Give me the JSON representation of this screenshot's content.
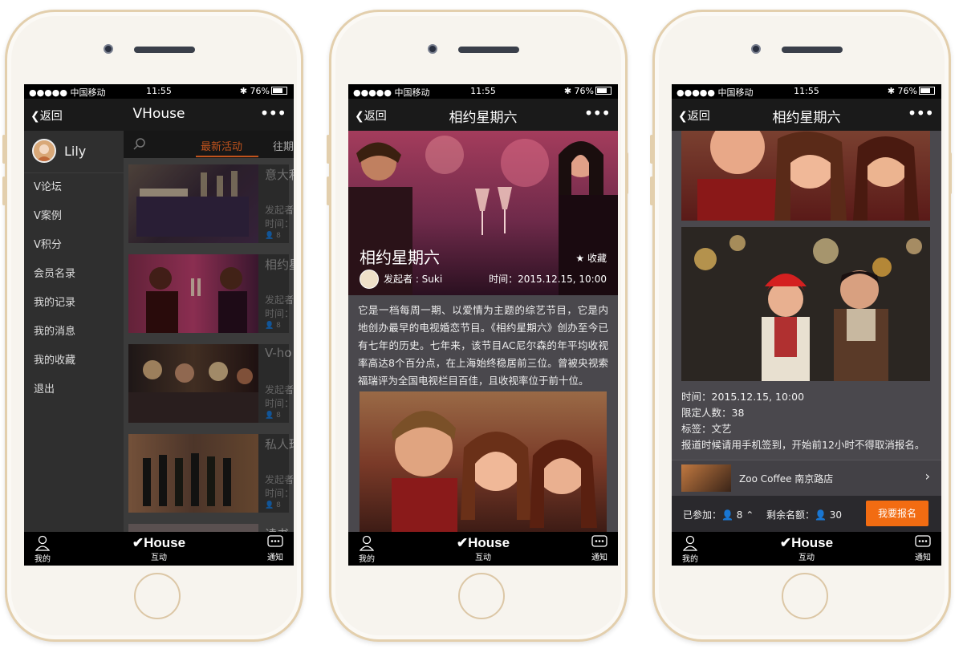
{
  "status": {
    "carrier": "●●●●● 中国移动",
    "time": "11:55",
    "battery": "76%"
  },
  "common": {
    "back": "返回",
    "more": "•••",
    "tab_me": "我的",
    "tab_logo": "House",
    "tab_interact": "互动",
    "tab_notice": "通知"
  },
  "phone1": {
    "title": "VHouse",
    "user": "Lily",
    "menu": [
      "V论坛",
      "V案例",
      "V积分",
      "会员名录",
      "我的记录",
      "我的消息",
      "我的收藏",
      "退出"
    ],
    "tab_latest": "最新活动",
    "tab_past": "往期",
    "cards": [
      {
        "title": "意大利",
        "m1": "发起者",
        "m2": "时间：",
        "m3": "8"
      },
      {
        "title": "相约星",
        "m1": "发起者",
        "m2": "时间：",
        "m3": "8"
      },
      {
        "title": "V-ho",
        "m1": "发起者",
        "m2": "时间：",
        "m3": "8"
      },
      {
        "title": "私人珍",
        "m1": "发起者",
        "m2": "时间：",
        "m3": "8"
      },
      {
        "title": "读书",
        "m1": "",
        "m2": "",
        "m3": ""
      }
    ]
  },
  "phone2": {
    "title": "相约星期六",
    "hero_title": "相约星期六",
    "fav": "收藏",
    "by": "发起者 : Suki",
    "time": "时间：2015.12.15, 10:00",
    "desc": "它是一档每周一期、以爱情为主题的综艺节目，它是内地创办最早的电视婚恋节目。《相约星期六》创办至今已有七年的历史。七年来，该节目AC尼尔森的年平均收视率高达8个百分点，在上海始终稳居前三位。曾被央视索福瑞评为全国电视栏目百佳，且收视率位于前十位。"
  },
  "phone3": {
    "title": "相约星期六",
    "time": "时间：2015.12.15, 10:00",
    "limit": "限定人数：38",
    "tag": "标签：文艺",
    "note": "报道时候请用手机签到，开始前12小时不得取消报名。",
    "venue": "Zoo Coffee 南京路店",
    "joined_label": "已参加：",
    "joined_count": "8",
    "remain_label": "剩余名额：",
    "remain_count": "30",
    "signup": "我要报名"
  }
}
